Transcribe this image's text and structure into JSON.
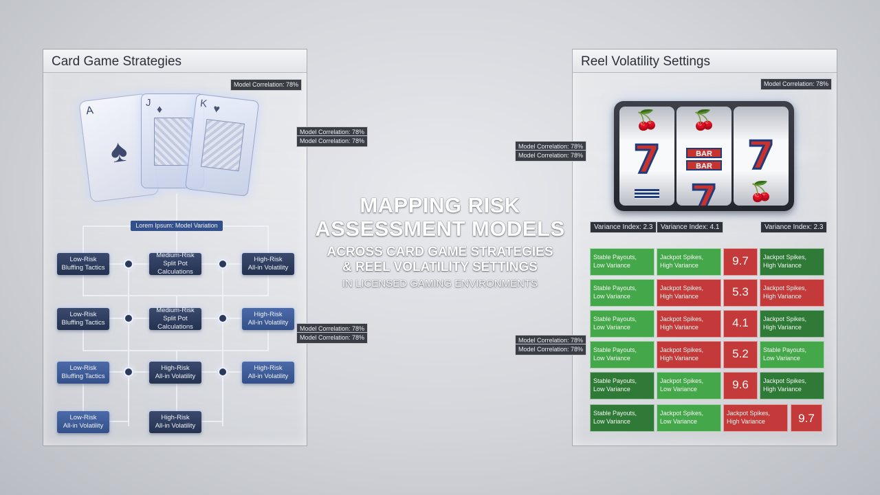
{
  "headline": {
    "line1": "MAPPING RISK",
    "line2": "ASSESSMENT MODELS",
    "line3": "ACROSS CARD GAME STRATEGIES",
    "line4": "& REEL VOLATILITY SETTINGS",
    "line5": "IN LICENSED GAMING ENVIRONMENTS"
  },
  "left_panel": {
    "title": "Card Game Strategies",
    "tags": {
      "t1": "Model Correlation: 78%",
      "t2a": "Model Correlation: 78%",
      "t2b": "Model Correlation: 78%",
      "t3a": "Model Correlation: 78%",
      "t3b": "Model Correlation: 78%"
    },
    "cards": {
      "ace": "A",
      "jack": "J",
      "king": "K"
    },
    "top_node": "Lorem Ipsum: Model Variation",
    "nodes": {
      "r1c1": "Low-Risk\nBluffing Tactics",
      "r1c2": "Medium-Risk\nSplit Pot Calculations",
      "r1c3": "High-Risk\nAll-in Volatility",
      "r2c1": "Low-Risk\nBluffing Tactics",
      "r2c2": "Medium-Risk\nSplit Pot Calculations",
      "r2c3": "High-Risk\nAll-in Volatility",
      "r3c1": "Low-Risk\nBluffing Tactics",
      "r3c2": "High-Risk\nAll-in Volatility",
      "r3c3": "High-Risk\nAll-in Volatility",
      "r4c1": "Low-Risk\nAll-in Volatility",
      "r4c2": "High-Risk\nAll-in Volatility"
    }
  },
  "right_panel": {
    "title": "Reel Volatility Settings",
    "tags": {
      "t1": "Model Correlation: 78%",
      "t2a": "Model Correlation: 78%",
      "t2b": "Model Correlation: 78%",
      "t3a": "Model Correlation: 78%",
      "t3b": "Model Correlation: 78%"
    },
    "reels": {
      "seven": "7",
      "bar": "BAR",
      "cherry": "🍒"
    },
    "variance": [
      "Variance Index: 2.3",
      "Variance Index: 4.1",
      "Variance Index: 2.3"
    ],
    "grid": [
      [
        "Stable Payouts,\nLow Variance",
        "Jackpot Spikes,\nHigh Variance",
        "9.7",
        "Jackpot Spikes,\nHigh Variance"
      ],
      [
        "Stable Payouts,\nLow Variance",
        "Jackpot Spikes,\nHigh Variance",
        "5.3",
        "Jackpot Spikes,\nHigh Variance"
      ],
      [
        "Stable Payouts,\nLow Variance",
        "Jackpot Spikes,\nHigh Variance",
        "4.1",
        "Jackpot Spikes,\nHigh Variance"
      ],
      [
        "Stable Payouts,\nLow Variance",
        "Jackpot Spikes,\nHigh Variance",
        "5.2",
        "Stable Payouts,\nLow Variance"
      ],
      [
        "Stable Payouts,\nLow Variance",
        "Jackpot Spikes,\nLow Variance",
        "9.6",
        "Jackpot Spikes,\nHigh Variance"
      ],
      [
        "Stable Payouts,\nLow Variance",
        "Jackpot Spikes,\nLow Variance",
        "Jackpot Spikes,\nHigh Variance",
        "9.7"
      ]
    ]
  }
}
